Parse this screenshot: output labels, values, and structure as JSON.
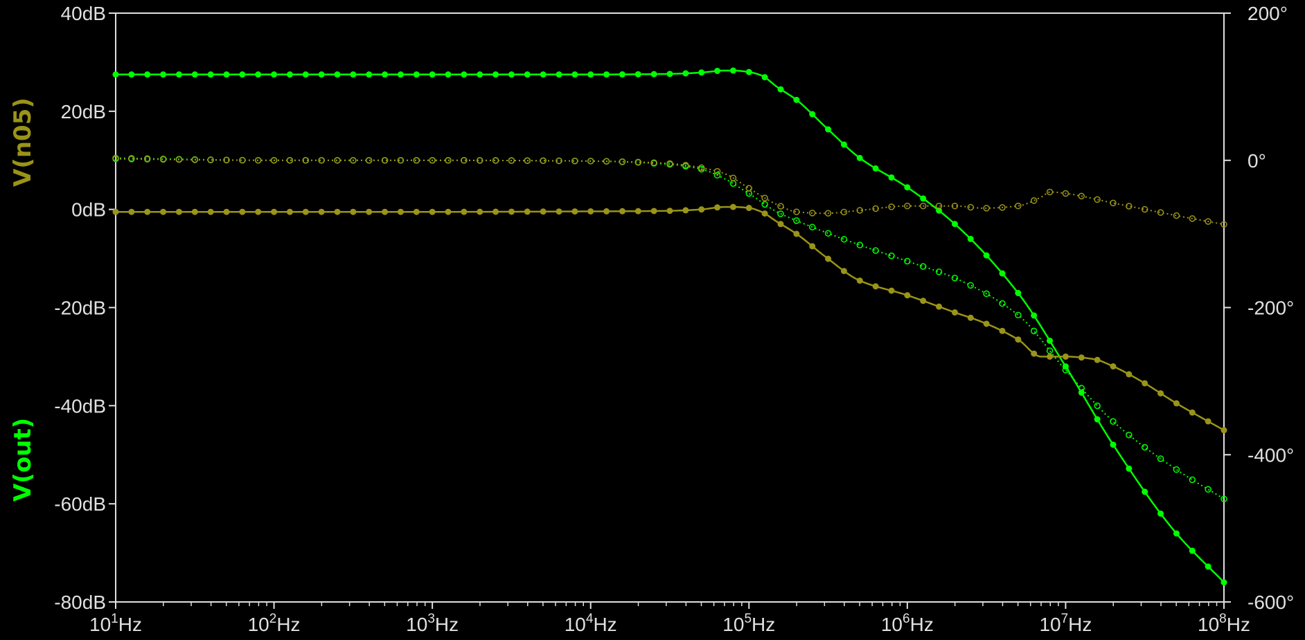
{
  "chart_data": {
    "type": "line",
    "title": "",
    "xlabel": "",
    "scale_x": "log",
    "xlim": [
      10,
      100000000
    ],
    "ylim_left_db": [
      -80,
      40
    ],
    "ylim_right_deg": [
      -600,
      200
    ],
    "grid": false,
    "legend": "left-vertical-labels",
    "colors": {
      "background": "#000000",
      "axis": "#e0e0e0",
      "out": "#00ff00",
      "n05": "#9a9418"
    },
    "x_tick_labels": [
      {
        "base": "10",
        "exp": "1",
        "unit": "Hz"
      },
      {
        "base": "10",
        "exp": "2",
        "unit": "Hz"
      },
      {
        "base": "10",
        "exp": "3",
        "unit": "Hz"
      },
      {
        "base": "10",
        "exp": "4",
        "unit": "Hz"
      },
      {
        "base": "10",
        "exp": "5",
        "unit": "Hz"
      },
      {
        "base": "10",
        "exp": "6",
        "unit": "Hz"
      },
      {
        "base": "10",
        "exp": "7",
        "unit": "Hz"
      },
      {
        "base": "10",
        "exp": "8",
        "unit": "Hz"
      }
    ],
    "y_left_tick_labels": [
      "40dB",
      "20dB",
      "0dB",
      "-20dB",
      "-40dB",
      "-60dB",
      "-80dB"
    ],
    "y_right_tick_labels": [
      "200°",
      "0°",
      "-200°",
      "-400°",
      "-600°"
    ],
    "series": [
      {
        "name": "V(out)",
        "quantity": "magnitude",
        "axis": "left",
        "units": "dB",
        "color": "#00ff00",
        "line": "solid",
        "x": [
          10,
          100.0,
          1000.0,
          10000.0,
          30000.0,
          50000.0,
          70000.0,
          80000.0,
          100000.0,
          120000.0,
          150000.0,
          200000.0,
          300000.0,
          500000.0,
          1000000.0,
          2000000.0,
          5000000.0,
          10000000.0,
          20000000.0,
          50000000.0,
          100000000.0
        ],
        "y": [
          27.5,
          27.5,
          27.5,
          27.5,
          27.6,
          27.9,
          28.3,
          28.3,
          28.0,
          27.3,
          25.0,
          22.3,
          17.0,
          10.5,
          4.5,
          -3.0,
          -17.0,
          -32.0,
          -48.0,
          -66.0,
          -76.0
        ]
      },
      {
        "name": "V(out)",
        "quantity": "phase",
        "axis": "right",
        "units": "deg",
        "color": "#00ff00",
        "line": "dotted",
        "x": [
          10,
          100.0,
          1000.0,
          10000.0,
          30000.0,
          50000.0,
          70000.0,
          100000.0,
          150000.0,
          200000.0,
          500000.0,
          1000000.0,
          2000000.0,
          5000000.0,
          10000000.0,
          20000000.0,
          50000000.0,
          100000000.0
        ],
        "y": [
          3,
          0,
          0,
          -1,
          -5,
          -12,
          -25,
          -45,
          -70,
          -82,
          -115,
          -137,
          -160,
          -210,
          -285,
          -355,
          -420,
          -460
        ]
      },
      {
        "name": "V(n05)",
        "quantity": "magnitude",
        "axis": "left",
        "units": "dB",
        "color": "#9a9418",
        "line": "solid",
        "x": [
          10,
          100.0,
          1000.0,
          10000.0,
          30000.0,
          50000.0,
          70000.0,
          80000.0,
          100000.0,
          120000.0,
          150000.0,
          200000.0,
          300000.0,
          500000.0,
          1000000.0,
          2000000.0,
          3000000.0,
          5000000.0,
          7000000.0,
          10000000.0,
          15000000.0,
          20000000.0,
          30000000.0,
          50000000.0,
          100000000.0
        ],
        "y": [
          -0.5,
          -0.5,
          -0.5,
          -0.4,
          -0.3,
          0.0,
          0.5,
          0.5,
          0.3,
          -0.5,
          -2.5,
          -5.0,
          -9.5,
          -14.5,
          -17.5,
          -21.0,
          -23.0,
          -26.5,
          -30.0,
          -30.0,
          -30.5,
          -32.0,
          -35.0,
          -39.5,
          -45.0
        ]
      },
      {
        "name": "V(n05)",
        "quantity": "phase",
        "axis": "right",
        "units": "deg",
        "color": "#9a9418",
        "line": "dotted",
        "x": [
          10,
          100.0,
          1000.0,
          10000.0,
          30000.0,
          50000.0,
          70000.0,
          100000.0,
          150000.0,
          200000.0,
          300000.0,
          500000.0,
          1000000.0,
          2000000.0,
          3000000.0,
          5000000.0,
          7000000.0,
          8000000.0,
          10000000.0,
          20000000.0,
          50000000.0,
          100000000.0
        ],
        "y": [
          2,
          0,
          0,
          -1,
          -4,
          -10,
          -18,
          -38,
          -60,
          -70,
          -72,
          -68,
          -62,
          -62,
          -65,
          -62,
          -50,
          -43,
          -45,
          -58,
          -75,
          -87
        ]
      }
    ]
  },
  "labels": {
    "trace_top": "V(n05)",
    "trace_bottom": "V(out)"
  }
}
